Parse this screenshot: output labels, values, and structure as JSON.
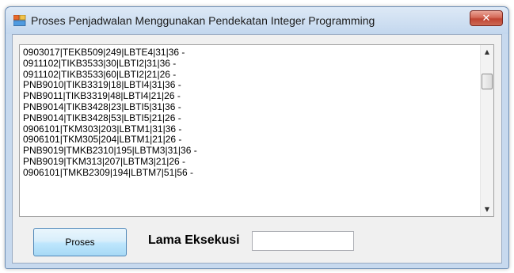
{
  "window": {
    "title": "Proses Penjadwalan Menggunakan Pendekatan Integer Programming",
    "close_glyph": "✕"
  },
  "output": {
    "lines": [
      "0903017|TEKB509|249|LBTE4|31|36 -",
      "0911102|TIKB3533|30|LBTI2|31|36 -",
      "0911102|TIKB3533|60|LBTI2|21|26 -",
      "PNB9010|TIKB3319|18|LBTI4|31|36 -",
      "PNB9011|TIKB3319|48|LBTI4|21|26 -",
      "PNB9014|TIKB3428|23|LBTI5|31|36 -",
      "PNB9014|TIKB3428|53|LBTI5|21|26 -",
      "0906101|TKM303|203|LBTM1|31|36 -",
      "0906101|TKM305|204|LBTM1|21|26 -",
      "PNB9019|TMKB2310|195|LBTM3|31|36 -",
      "PNB9019|TKM313|207|LBTM3|21|26 -",
      "0906101|TMKB2309|194|LBTM7|51|56 -"
    ]
  },
  "controls": {
    "proses_label": "Proses",
    "lama_eksekusi_label": "Lama Eksekusi",
    "lama_eksekusi_value": ""
  },
  "colors": {
    "frame": "#c7d9ee",
    "client_bg": "#f0f0f0",
    "close_red": "#c04432",
    "button_blue": "#bee6fd"
  },
  "icons": {
    "app": "form-app-icon",
    "close": "close-icon",
    "scroll_up": "scroll-up-arrow-icon",
    "scroll_down": "scroll-down-arrow-icon"
  }
}
